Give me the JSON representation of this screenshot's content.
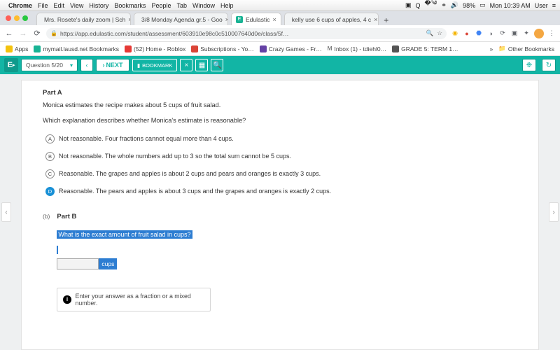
{
  "mac": {
    "app": "Chrome",
    "menu": [
      "File",
      "Edit",
      "View",
      "History",
      "Bookmarks",
      "People",
      "Tab",
      "Window",
      "Help"
    ],
    "battery": "98%",
    "clock": "Mon 10:39 AM",
    "user": "User"
  },
  "tabs": [
    {
      "title": "Mrs. Rosete's daily zoom | Sch",
      "fav": "S"
    },
    {
      "title": "3/8 Monday Agenda gr.5 - Goo",
      "fav": "G"
    },
    {
      "title": "Edulastic",
      "fav": "E",
      "active": true
    },
    {
      "title": "kelly use 6 cups of apples, 4 c",
      "fav": "J"
    }
  ],
  "url": "https://app.edulastic.com/student/assessment/603910e98c0c510007640d0e/class/5f…",
  "bookmarks": [
    {
      "label": "Apps",
      "icon": "bi1"
    },
    {
      "label": "mymail.lausd.net Bookmarks",
      "icon": "bi2"
    },
    {
      "label": "(52) Home - Roblox",
      "icon": "bi3"
    },
    {
      "label": "Subscriptions - Yo…",
      "icon": "bi4"
    },
    {
      "label": "Crazy Games - Fr…",
      "icon": "bi5"
    },
    {
      "label": "Inbox (1) - tdiehl0…",
      "icon": "bi6"
    },
    {
      "label": "GRADE 5: TERM 1…",
      "icon": "bi7"
    }
  ],
  "bm_more": "»",
  "bm_other": "Other Bookmarks",
  "appbar": {
    "logo": "E",
    "question": "Question 5/20",
    "next": "NEXT",
    "bookmark": "BOOKMARK"
  },
  "question": {
    "partA_title": "Part A",
    "line1": "Monica estimates the recipe makes about 5 cups of fruit salad.",
    "line2": "Which explanation describes whether Monica's estimate is reasonable?",
    "options": [
      {
        "k": "A",
        "t": "Not reasonable.  Four fractions cannot equal more than 4 cups."
      },
      {
        "k": "B",
        "t": "Not reasonable. The whole numbers add up to 3 so the total sum cannot be 5 cups."
      },
      {
        "k": "C",
        "t": "Reasonable. The grapes and apples is about 2 cups and pears and oranges is exactly 3 cups."
      },
      {
        "k": "D",
        "t": "Reasonable. The pears and apples is about 3 cups and the grapes and oranges is exactly 2 cups.",
        "sel": true
      }
    ],
    "partB_marker": "(b)",
    "partB_title": "Part B",
    "partB_q": "What is the exact amount of fruit salad in cups?",
    "unit": "cups",
    "hint": "Enter your answer as a fraction or a mixed number."
  }
}
